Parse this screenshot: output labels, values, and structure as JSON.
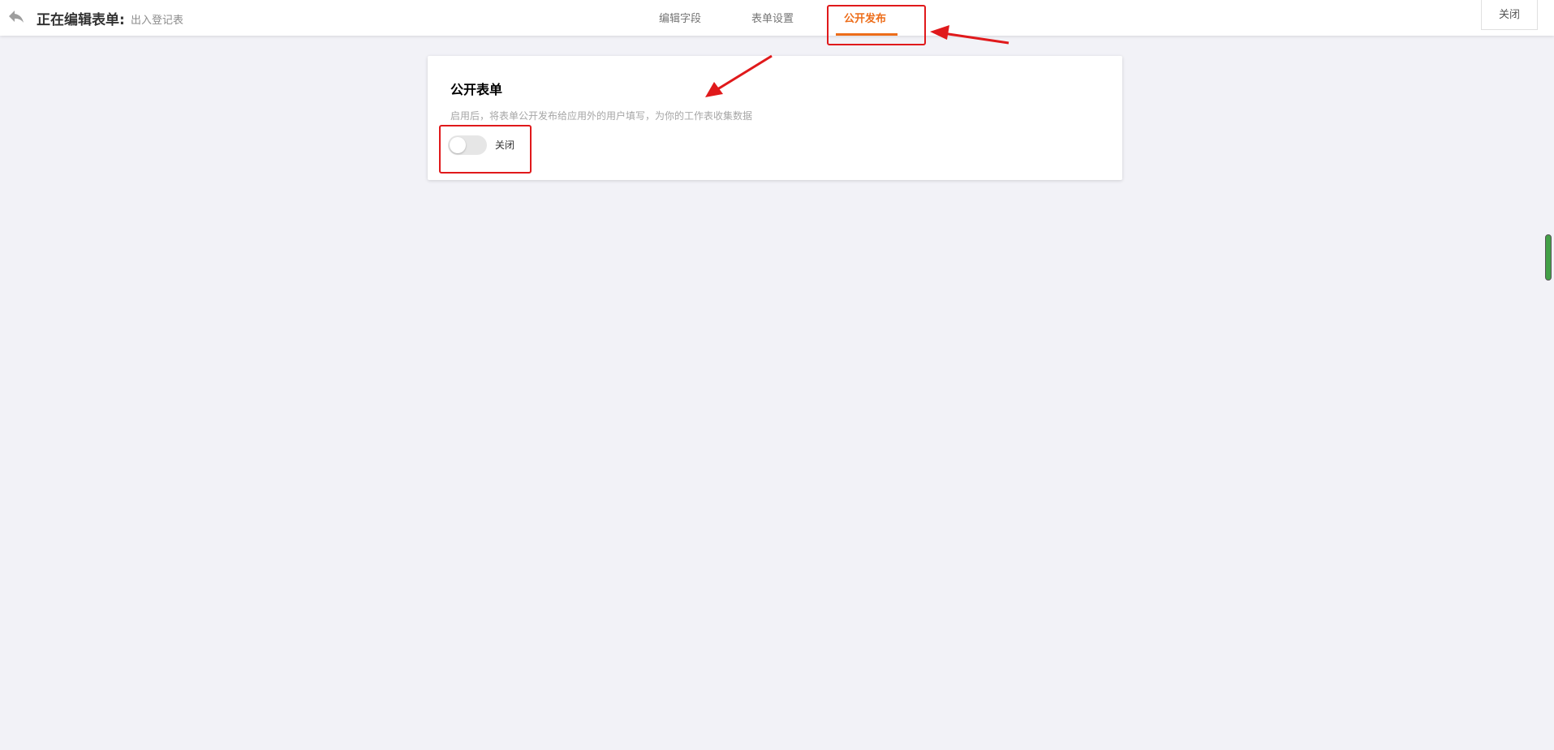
{
  "header": {
    "title": "正在编辑表单:",
    "form_name": "出入登记表",
    "back_icon": "reply-arrow-icon",
    "tabs": [
      {
        "label": "编辑字段",
        "active": false
      },
      {
        "label": "表单设置",
        "active": false
      },
      {
        "label": "公开发布",
        "active": true
      }
    ],
    "close_label": "关闭"
  },
  "card": {
    "title": "公开表单",
    "description": "启用后，将表单公开发布给应用外的用户填写，为你的工作表收集数据",
    "toggle": {
      "state": false,
      "label": "关闭"
    }
  },
  "colors": {
    "accent": "#ed6d1a",
    "background": "#f2f2f7",
    "annotation": "#e0191b",
    "scrollbar": "#43a047"
  }
}
